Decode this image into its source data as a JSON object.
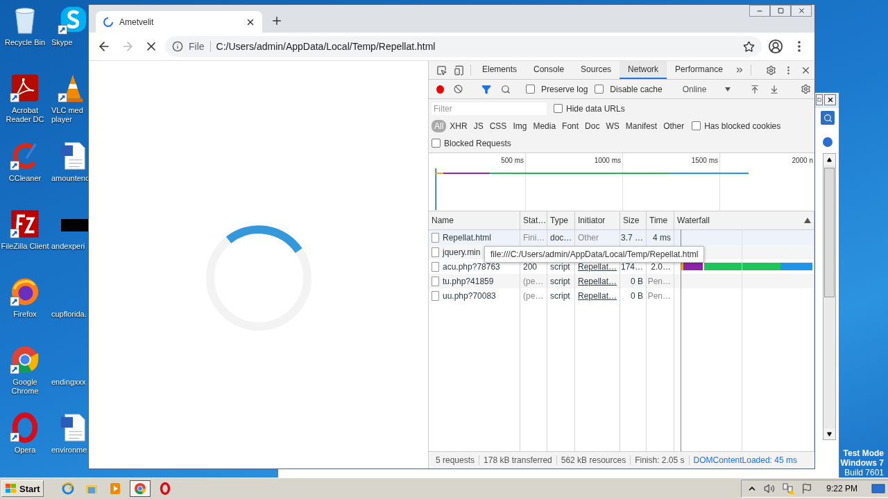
{
  "desktop": {
    "icons": [
      {
        "kind": "recycle",
        "label": "Recycle Bin",
        "shortcut": false
      },
      {
        "kind": "skype",
        "label": "Skype",
        "shortcut": true
      },
      {
        "kind": "acrobat",
        "label": "Acrobat\nReader DC",
        "shortcut": true
      },
      {
        "kind": "vlc",
        "label": "VLC med\nplayer",
        "shortcut": true
      },
      {
        "kind": "ccleaner",
        "label": "CCleaner",
        "shortcut": true
      },
      {
        "kind": "word",
        "label": "amountenc",
        "shortcut": false
      },
      {
        "kind": "filezilla",
        "label": "FileZilla Client",
        "shortcut": true
      },
      {
        "kind": "blackbox",
        "label": "andexperi",
        "shortcut": false
      },
      {
        "kind": "firefox",
        "label": "Firefox",
        "shortcut": true
      },
      {
        "kind": "blank",
        "label": "cupflorida.",
        "shortcut": false
      },
      {
        "kind": "chrome",
        "label": "Google\nChrome",
        "shortcut": true
      },
      {
        "kind": "blank",
        "label": "endingxxx",
        "shortcut": false
      },
      {
        "kind": "opera",
        "label": "Opera",
        "shortcut": true
      },
      {
        "kind": "word",
        "label": "environme",
        "shortcut": false
      }
    ]
  },
  "browser": {
    "loading": true,
    "forward_disabled": true,
    "tab": {
      "title": "Ametvelit"
    },
    "address": {
      "scheme": "File",
      "url": "C:/Users/admin/AppData/Local/Temp/Repellat.html"
    }
  },
  "devtools": {
    "tabs": [
      {
        "label": "Elements",
        "selected": false
      },
      {
        "label": "Console",
        "selected": false
      },
      {
        "label": "Sources",
        "selected": false
      },
      {
        "label": "Network",
        "selected": true
      },
      {
        "label": "Performance",
        "selected": false
      }
    ],
    "recording": true,
    "checkboxes": [
      {
        "label": "Preserve log",
        "checked": false
      },
      {
        "label": "Disable cache",
        "checked": false
      }
    ],
    "throttling": "Online",
    "filter": {
      "placeholder": "Filter"
    },
    "hide_data_urls": {
      "label": "Hide data URLs",
      "checked": false
    },
    "types": [
      {
        "label": "All",
        "selected": true
      },
      {
        "label": "XHR",
        "selected": false
      },
      {
        "label": "JS",
        "selected": false
      },
      {
        "label": "CSS",
        "selected": false
      },
      {
        "label": "Img",
        "selected": false
      },
      {
        "label": "Media",
        "selected": false
      },
      {
        "label": "Font",
        "selected": false
      },
      {
        "label": "Doc",
        "selected": false
      },
      {
        "label": "WS",
        "selected": false
      },
      {
        "label": "Manifest",
        "selected": false
      },
      {
        "label": "Other",
        "selected": false
      }
    ],
    "has_blocked_cookies": {
      "label": "Has blocked cookies",
      "checked": false
    },
    "blocked_requests": {
      "label": "Blocked Requests",
      "checked": false
    },
    "overview": {
      "ticks": [
        "500 ms",
        "1000 ms",
        "1500 ms",
        "2000 n"
      ]
    },
    "table": {
      "columns": [
        "Name",
        "Stat…",
        "Type",
        "Initiator",
        "Size",
        "Time",
        "Waterfall"
      ],
      "rows": [
        {
          "selected": true,
          "timing_bar": false,
          "cells": [
            {
              "text": "Repellat.html",
              "kind": "text"
            },
            {
              "text": "Fini…",
              "kind": "muted"
            },
            {
              "text": "doc…",
              "kind": "text"
            },
            {
              "text": "Other",
              "kind": "muted"
            },
            {
              "text": "3.7 …",
              "kind": "text"
            },
            {
              "text": "4 ms",
              "kind": "text"
            }
          ]
        },
        {
          "selected": false,
          "timing_bar": false,
          "cells": [
            {
              "text": "jquery.min",
              "kind": "text"
            }
          ]
        },
        {
          "selected": false,
          "timing_bar": true,
          "cells": [
            {
              "text": "acu.php?78763",
              "kind": "text"
            },
            {
              "text": "200",
              "kind": "text"
            },
            {
              "text": "script",
              "kind": "text"
            },
            {
              "text": "Repellat…",
              "kind": "link"
            },
            {
              "text": "174…",
              "kind": "text"
            },
            {
              "text": "2.0…",
              "kind": "text"
            }
          ]
        },
        {
          "selected": false,
          "timing_bar": false,
          "cells": [
            {
              "text": "tu.php?41859",
              "kind": "text"
            },
            {
              "text": "(pe…",
              "kind": "muted"
            },
            {
              "text": "script",
              "kind": "text"
            },
            {
              "text": "Repellat…",
              "kind": "link"
            },
            {
              "text": "0 B",
              "kind": "text"
            },
            {
              "text": "Pen…",
              "kind": "muted"
            }
          ]
        },
        {
          "selected": false,
          "timing_bar": false,
          "cells": [
            {
              "text": "uu.php?70083",
              "kind": "text"
            },
            {
              "text": "(pe…",
              "kind": "muted"
            },
            {
              "text": "script",
              "kind": "text"
            },
            {
              "text": "Repellat…",
              "kind": "link"
            },
            {
              "text": "0 B",
              "kind": "text"
            },
            {
              "text": "Pen…",
              "kind": "muted"
            }
          ]
        }
      ],
      "tooltip": "file:///C:/Users/admin/AppData/Local/Temp/Repellat.html"
    },
    "summary": [
      {
        "text": "5 requests",
        "kind": "text"
      },
      {
        "text": "178 kB transferred",
        "kind": "text"
      },
      {
        "text": "562 kB resources",
        "kind": "text"
      },
      {
        "text": "Finish: 2.05 s",
        "kind": "text"
      },
      {
        "text": "DOMContentLoaded: 45 ms",
        "kind": "link"
      }
    ]
  },
  "system": {
    "test_mode": [
      "Test Mode",
      "Windows 7",
      "Build 7601"
    ]
  },
  "taskbar": {
    "start": "Start",
    "apps": [
      {
        "kind": "ie",
        "selected": false
      },
      {
        "kind": "explorer",
        "selected": false
      },
      {
        "kind": "media",
        "selected": false
      },
      {
        "kind": "chrome",
        "selected": true
      },
      {
        "kind": "opera",
        "selected": false
      }
    ],
    "clock": "9:22 PM"
  }
}
